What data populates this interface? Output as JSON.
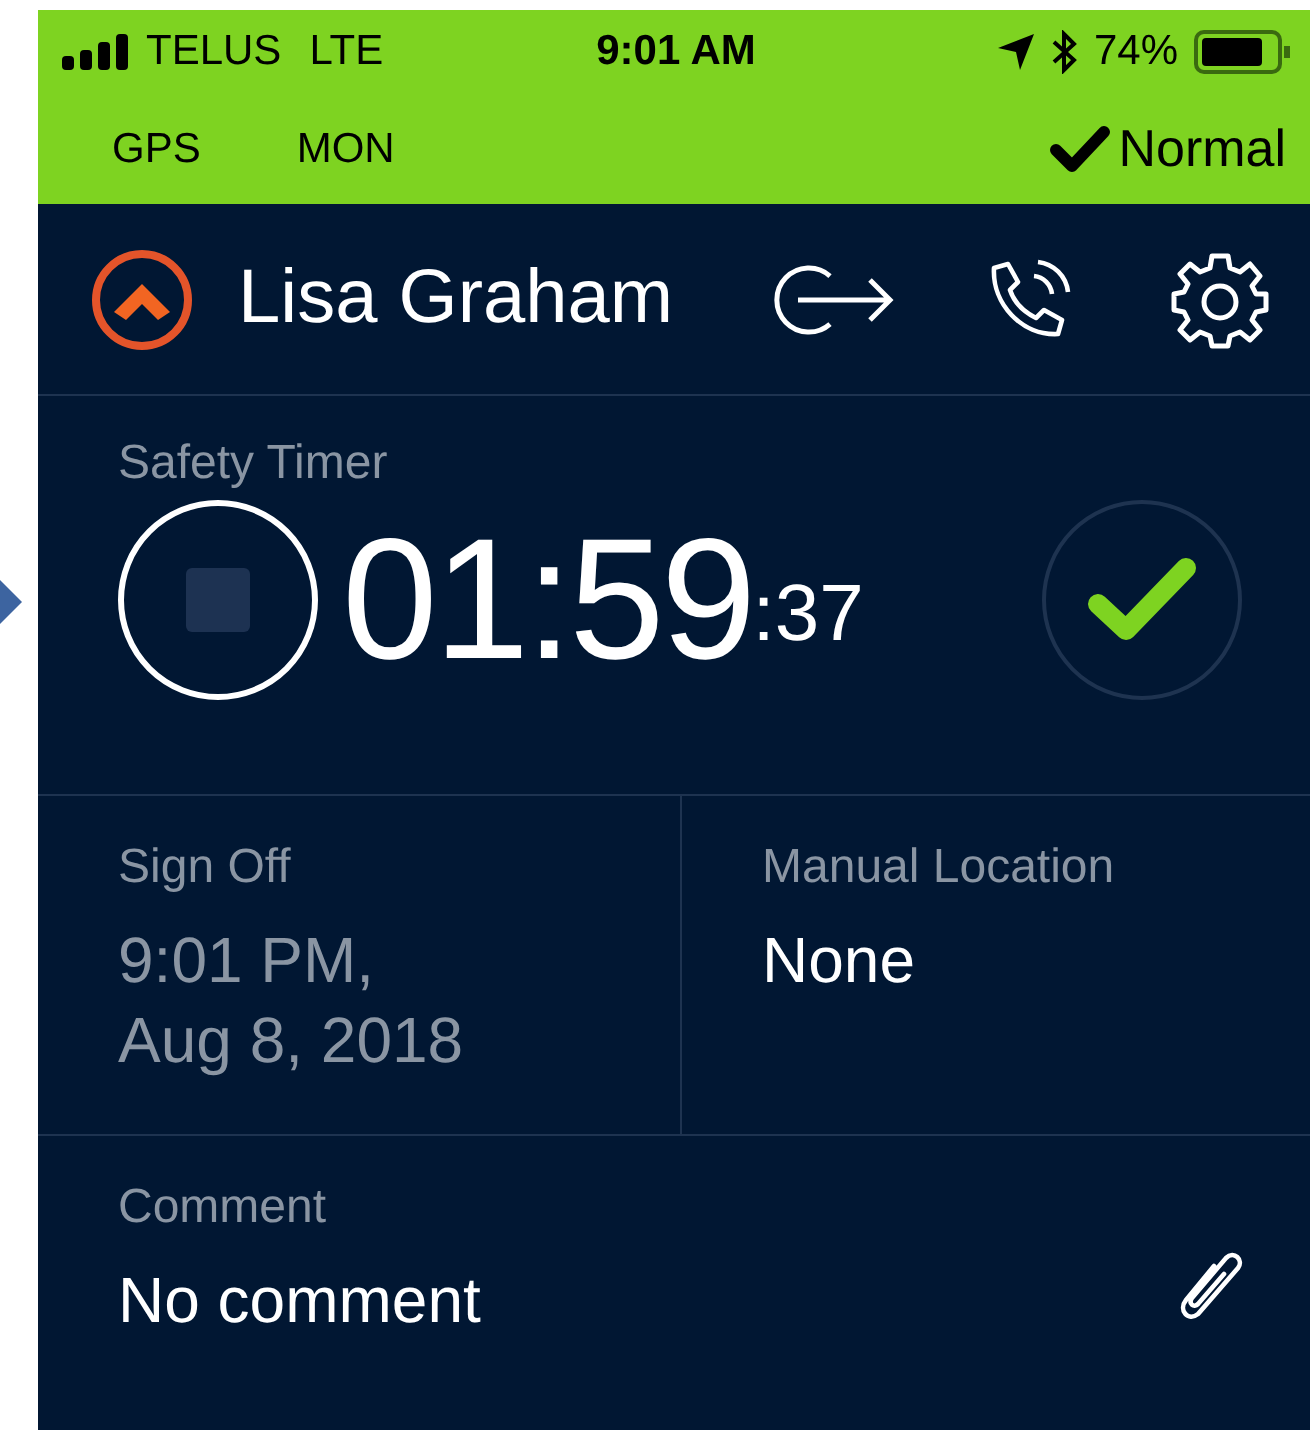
{
  "status_bar": {
    "carrier": "TELUS",
    "network": "LTE",
    "time": "9:01 AM",
    "battery": "74%"
  },
  "mode_bar": {
    "items": [
      "GPS",
      "MON"
    ],
    "status": "Normal"
  },
  "header": {
    "name": "Lisa Graham"
  },
  "timer": {
    "label": "Safety Timer",
    "time": "01:59",
    "seconds": ":37"
  },
  "fields": [
    {
      "label": "Sign Off",
      "value": "9:01 PM,\nAug 8, 2018",
      "dim": true
    },
    {
      "label": "Manual Location",
      "value": "None",
      "dim": false
    }
  ],
  "comment": {
    "label": "Comment",
    "value": "No comment"
  }
}
